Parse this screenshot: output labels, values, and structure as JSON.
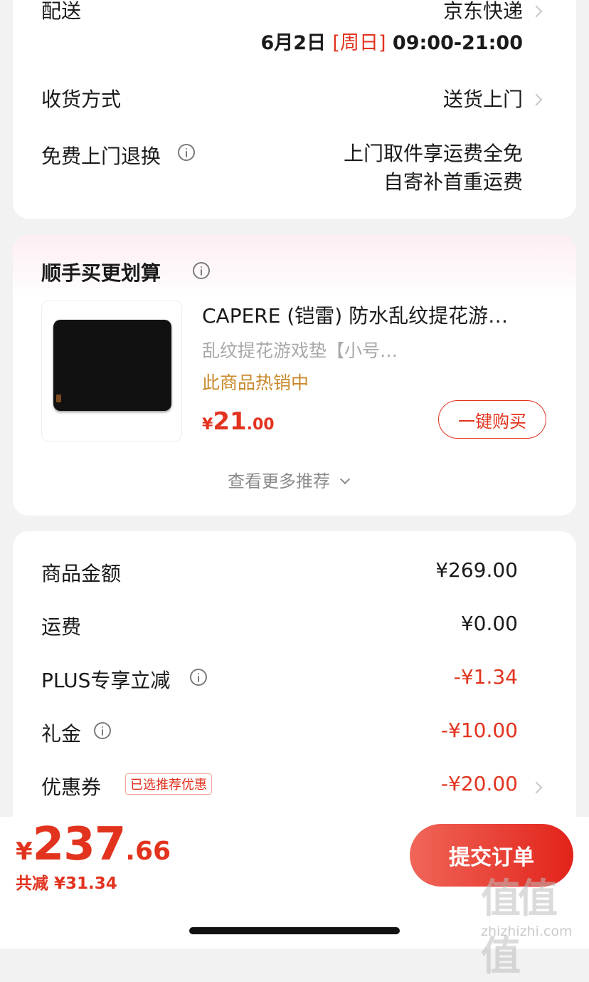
{
  "delivery": {
    "label": "配送",
    "carrier": "京东快递",
    "date": "6月2日",
    "weekday": "[周日]",
    "time": "09:00-21:00",
    "receive_label": "收货方式",
    "receive_value": "送货上门",
    "return_label": "免费上门退换",
    "return_line1": "上门取件享运费全免",
    "return_line2": "自寄补首重运费"
  },
  "upsell": {
    "title": "顺手买更划算",
    "product": {
      "title": "CAPERE (铠雷) 防水乱纹提花游…",
      "subtitle": "乱纹提花游戏垫【小号…",
      "hot": "此商品热销中",
      "currency": "¥",
      "price_int": "21",
      "price_dec": ".00",
      "buy_label": "一键购买"
    },
    "more_label": "查看更多推荐"
  },
  "summary": {
    "rows": [
      {
        "label": "商品金额",
        "value": "¥269.00"
      },
      {
        "label": "运费",
        "value": "¥0.00"
      },
      {
        "label": "PLUS专享立减",
        "value": "-¥1.34"
      },
      {
        "label": "礼金",
        "value": "-¥10.00"
      },
      {
        "label": "优惠券",
        "value": "-¥20.00",
        "tag": "已选推荐优惠"
      }
    ]
  },
  "footer": {
    "currency": "¥",
    "total_int": "237",
    "total_dec": ".66",
    "saved": "共减 ¥31.34",
    "submit_label": "提交订单"
  },
  "watermark": {
    "logo": "值值值",
    "url": "zhizhizhi.com"
  },
  "colors": {
    "accent": "#e2331f",
    "hot": "#c8892a"
  },
  "icons": [
    "chevron-right-icon",
    "info-icon",
    "chevron-down-icon"
  ]
}
